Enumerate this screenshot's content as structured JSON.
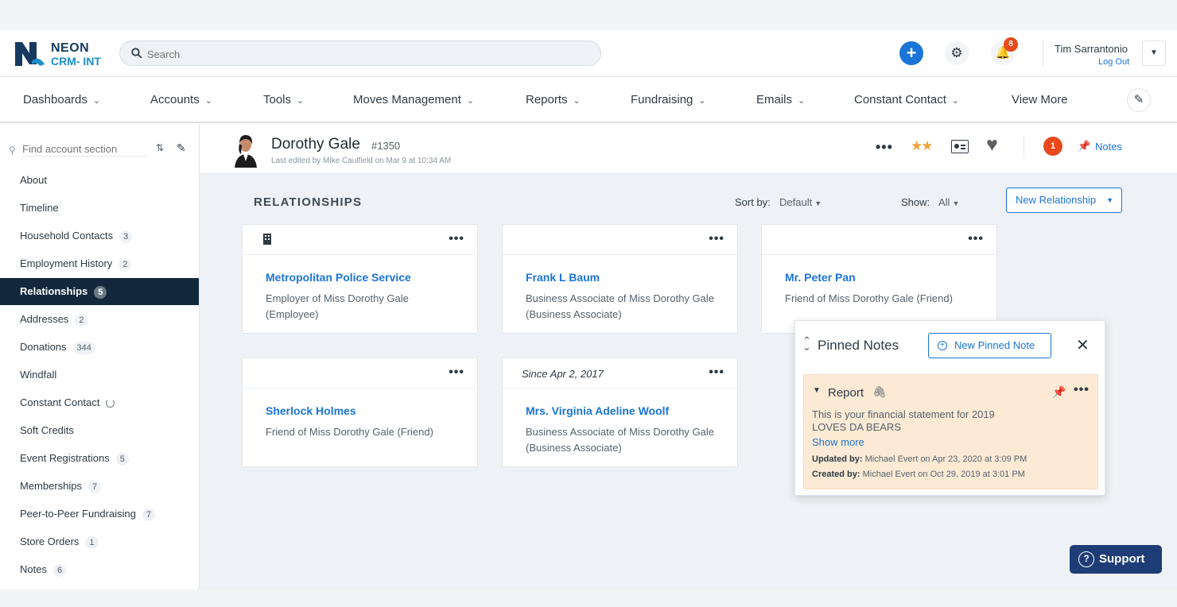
{
  "brand": {
    "name_line1": "NEON",
    "name_line2": "CRM- INT"
  },
  "search": {
    "placeholder": "Search"
  },
  "topbar": {
    "notification_count": "8",
    "user_name": "Tim Sarrantonio",
    "logout_label": "Log Out"
  },
  "nav": {
    "items": [
      {
        "label": "Dashboards"
      },
      {
        "label": "Accounts"
      },
      {
        "label": "Tools"
      },
      {
        "label": "Moves Management"
      },
      {
        "label": "Reports"
      },
      {
        "label": "Fundraising"
      },
      {
        "label": "Emails"
      },
      {
        "label": "Constant Contact"
      },
      {
        "label": "View More"
      }
    ]
  },
  "sidebar": {
    "search_placeholder": "Find account section",
    "items": [
      {
        "label": "About",
        "count": ""
      },
      {
        "label": "Timeline",
        "count": ""
      },
      {
        "label": "Household Contacts",
        "count": "3"
      },
      {
        "label": "Employment History",
        "count": "2"
      },
      {
        "label": "Relationships",
        "count": "5",
        "active": true
      },
      {
        "label": "Addresses",
        "count": "2"
      },
      {
        "label": "Donations",
        "count": "344"
      },
      {
        "label": "Windfall",
        "count": ""
      },
      {
        "label": "Constant Contact",
        "count": ""
      },
      {
        "label": "Soft Credits",
        "count": ""
      },
      {
        "label": "Event Registrations",
        "count": "5"
      },
      {
        "label": "Memberships",
        "count": "7"
      },
      {
        "label": "Peer-to-Peer Fundraising",
        "count": "7"
      },
      {
        "label": "Store Orders",
        "count": "1"
      },
      {
        "label": "Notes",
        "count": "6"
      }
    ]
  },
  "record": {
    "name": "Dorothy Gale",
    "id": "#1350",
    "last_edited": "Last edited by Mike Caulfield on Mar 9 at 10:34 AM",
    "alert_count": "1",
    "notes_label": "Notes"
  },
  "relationships": {
    "title": "RELATIONSHIPS",
    "sort_label": "Sort by:",
    "sort_value": "Default",
    "show_label": "Show:",
    "show_value": "All",
    "new_button": "New Relationship",
    "cards": [
      {
        "since": "",
        "name": "Metropolitan Police Service",
        "description": "Employer of Miss Dorothy Gale (Employee)"
      },
      {
        "since": "",
        "name": "Frank L Baum",
        "description": "Business Associate of Miss Dorothy Gale (Business Associate)"
      },
      {
        "since": "",
        "name": "Mr. Peter Pan",
        "description": "Friend of Miss Dorothy Gale (Friend)"
      },
      {
        "since": "",
        "name": "Sherlock Holmes",
        "description": "Friend of Miss Dorothy Gale (Friend)"
      },
      {
        "since": "Since Apr 2, 2017",
        "name": "Mrs. Virginia Adeline Woolf",
        "description": "Business Associate of Miss Dorothy Gale (Business Associate)"
      }
    ]
  },
  "pinned_notes": {
    "title": "Pinned Notes",
    "new_button": "New Pinned Note",
    "note": {
      "title": "Report",
      "body_line1": "This is your financial statement for 2019",
      "body_line2": "LOVES DA BEARS",
      "show_more": "Show more",
      "updated_label": "Updated by:",
      "updated_value": "Michael Evert on Apr 23, 2020 at 3:09 PM",
      "created_label": "Created by:",
      "created_value": "Michael Evert on Oct 29, 2019 at 3:01 PM"
    }
  },
  "support": {
    "label": "Support"
  },
  "colors": {
    "accent": "#1a74d8",
    "sidebar_active": "#13283d",
    "badge": "#e8491d",
    "note_bg": "#fcead5",
    "support_bg": "#1e3d76"
  }
}
